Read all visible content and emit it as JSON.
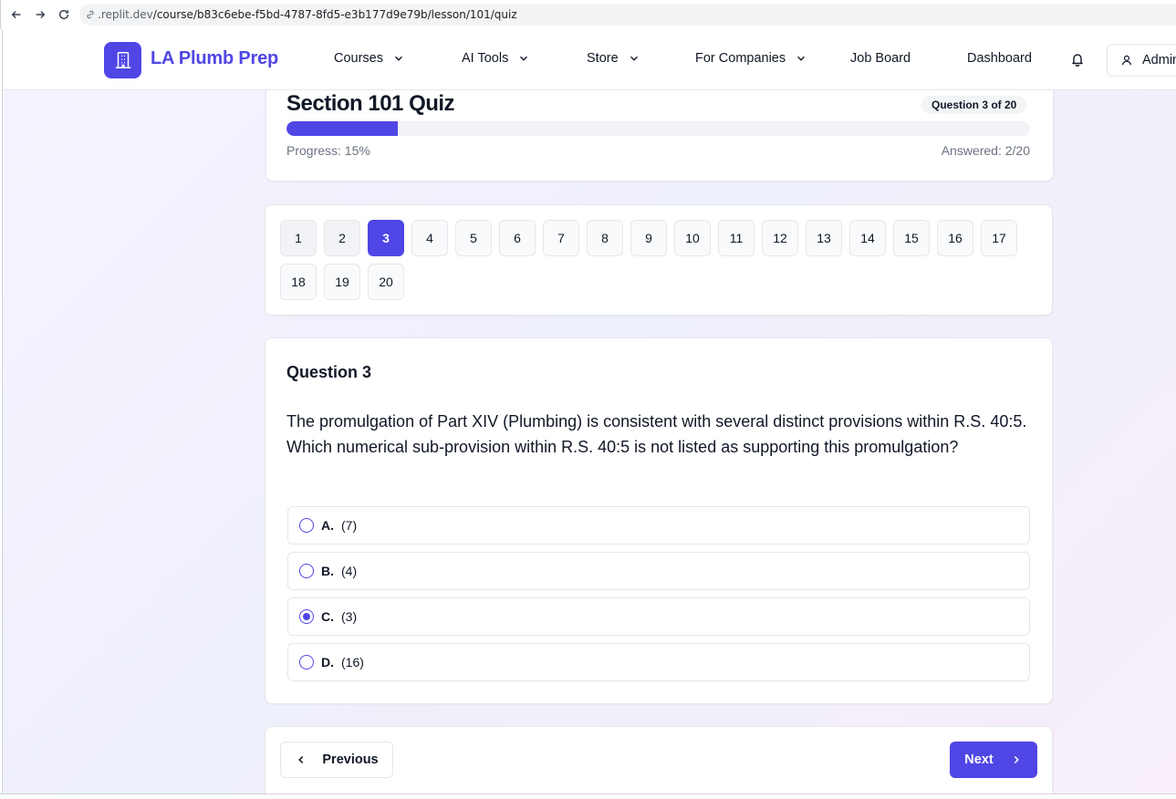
{
  "browser": {
    "url_prefix": ".replit.dev",
    "url_path": "/course/b83c6ebe-f5bd-4787-8fd5-e3b177d9e79b/lesson/101/quiz"
  },
  "header": {
    "brand": "LA Plumb Prep",
    "nav": [
      {
        "label": "Courses",
        "dropdown": true
      },
      {
        "label": "AI Tools",
        "dropdown": true
      },
      {
        "label": "Store",
        "dropdown": true
      },
      {
        "label": "For Companies",
        "dropdown": true
      },
      {
        "label": "Job Board",
        "dropdown": false
      },
      {
        "label": "Dashboard",
        "dropdown": false
      }
    ],
    "user_label": "Admin"
  },
  "quiz": {
    "title": "Section 101 Quiz",
    "question_badge": "Question 3 of 20",
    "progress_percent": 15,
    "progress_label": "Progress: 15%",
    "answered_label": "Answered: 2/20",
    "accent": "#4f46e5"
  },
  "grid": {
    "numbers": [
      "1",
      "2",
      "3",
      "4",
      "5",
      "6",
      "7",
      "8",
      "9",
      "10",
      "11",
      "12",
      "13",
      "14",
      "15",
      "16",
      "17",
      "18",
      "19",
      "20"
    ],
    "current": 3,
    "answered": [
      1,
      2
    ]
  },
  "question": {
    "heading": "Question 3",
    "text": "The promulgation of Part XIV (Plumbing) is consistent with several distinct provisions within R.S. 40:5. Which numerical sub-provision within R.S. 40:5 is not listed as supporting this promulgation?",
    "options": [
      {
        "letter": "A.",
        "text": "(7)",
        "selected": false
      },
      {
        "letter": "B.",
        "text": "(4)",
        "selected": false
      },
      {
        "letter": "C.",
        "text": "(3)",
        "selected": true
      },
      {
        "letter": "D.",
        "text": "(16)",
        "selected": false
      }
    ]
  },
  "footer": {
    "previous_label": "Previous",
    "next_label": "Next"
  }
}
